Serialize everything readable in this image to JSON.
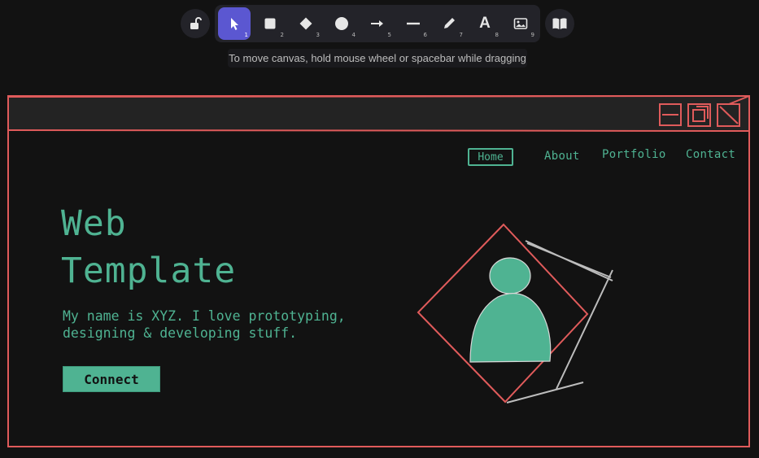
{
  "toolbar": {
    "tools": [
      {
        "icon": "pointer-icon",
        "key": "1",
        "active": true
      },
      {
        "icon": "rectangle-icon",
        "key": "2"
      },
      {
        "icon": "diamond-icon",
        "key": "3"
      },
      {
        "icon": "ellipse-icon",
        "key": "4"
      },
      {
        "icon": "arrow-icon",
        "key": "5"
      },
      {
        "icon": "line-icon",
        "key": "6"
      },
      {
        "icon": "pencil-icon",
        "key": "7"
      },
      {
        "icon": "text-icon",
        "key": "8"
      },
      {
        "icon": "image-icon",
        "key": "9"
      }
    ],
    "text_glyph": "A",
    "hint": "To move canvas, hold mouse wheel or spacebar while dragging"
  },
  "canvas": {
    "nav": {
      "home": "Home",
      "about": "About",
      "portfolio": "Portfolio",
      "contact": "Contact"
    },
    "hero": {
      "title_line1": "Web",
      "title_line2": "Template",
      "text_line1": "My name is XYZ. I love prototyping,",
      "text_line2": "designing & developing stuff.",
      "button": "Connect"
    }
  },
  "colors": {
    "accent": "#5b57d1",
    "sketch_red": "#e05b5b",
    "sketch_green": "#4fb392",
    "background": "#121212"
  }
}
